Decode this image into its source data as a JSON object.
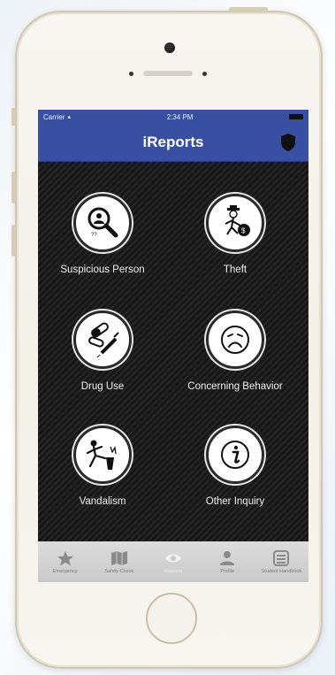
{
  "status_bar": {
    "carrier": "Carrier",
    "time": "2:34 PM"
  },
  "nav": {
    "title": "iReports",
    "accent_color": "#394fa2"
  },
  "report_tiles": [
    {
      "label": "Suspicious Person",
      "icon": "magnifier-person-icon"
    },
    {
      "label": "Theft",
      "icon": "thief-money-bag-icon"
    },
    {
      "label": "Drug Use",
      "icon": "pills-syringe-icon"
    },
    {
      "label": "Concerning Behavior",
      "icon": "worried-face-icon"
    },
    {
      "label": "Vandalism",
      "icon": "person-kicking-bin-icon"
    },
    {
      "label": "Other Inquiry",
      "icon": "info-icon"
    }
  ],
  "tab_bar": [
    {
      "label": "Emergency",
      "icon": "star-icon",
      "active": false
    },
    {
      "label": "Safety Check",
      "icon": "map-icon",
      "active": false
    },
    {
      "label": "iReports",
      "icon": "eye-icon",
      "active": true
    },
    {
      "label": "Profile",
      "icon": "person-icon",
      "active": false
    },
    {
      "label": "Student Handbook",
      "icon": "book-icon",
      "active": false
    }
  ]
}
